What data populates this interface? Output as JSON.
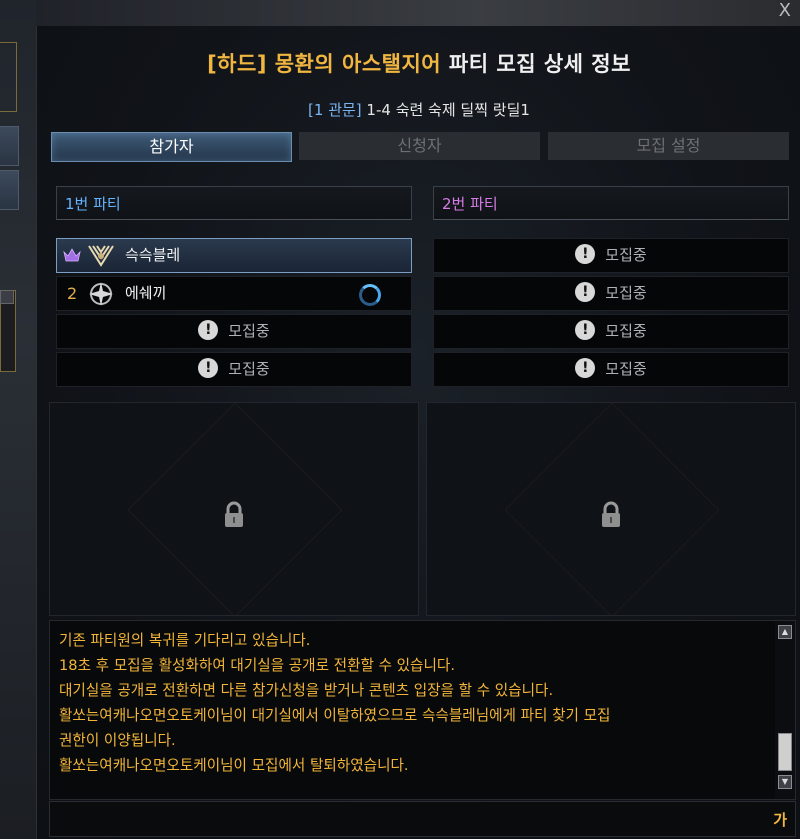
{
  "window": {
    "close_label": "X",
    "title_prefix": "[하드] 몽환의 아스탤지어",
    "title_suffix": " 파티 모집 상세 정보",
    "subtitle_tag": "[1 관문]",
    "subtitle_text": " 1-4 숙련 숙제 딜찍 랏딜1"
  },
  "tabs": [
    {
      "label": "참가자",
      "active": true
    },
    {
      "label": "신청자",
      "active": false
    },
    {
      "label": "모집 설정",
      "active": false
    }
  ],
  "party1": {
    "title": "1번 파티",
    "members": [
      {
        "name": "슥슥블레",
        "leader": true
      },
      {
        "slot": "2",
        "name": "에쉐끼",
        "loading": true
      }
    ],
    "recruiting": [
      "모집중",
      "모집중"
    ]
  },
  "party2": {
    "title": "2번 파티",
    "recruiting": [
      "모집중",
      "모집중",
      "모집중",
      "모집중"
    ]
  },
  "chat": {
    "lines": [
      "기존 파티원의 복귀를 기다리고 있습니다.",
      "18초 후 모집을 활성화하여 대기실을 공개로 전환할 수 있습니다.",
      "대기실을 공개로 전환하면 다른 참가신청을 받거나 콘텐츠 입장을 할 수 있습니다.",
      "활쏘는여캐나오면오토케이님이 대기실에서 이탈하였으므로 슥슥블레님에게 파티 찾기 모집",
      "권한이 이양됩니다.",
      "활쏘는여캐나오면오토케이님이 모집에서 탈퇴하였습니다."
    ],
    "ime_indicator": "가"
  },
  "colors": {
    "gold": "#f0b640",
    "party1": "#66b3ff",
    "party2": "#d77ce6",
    "chat_text": "#f2b53a"
  }
}
